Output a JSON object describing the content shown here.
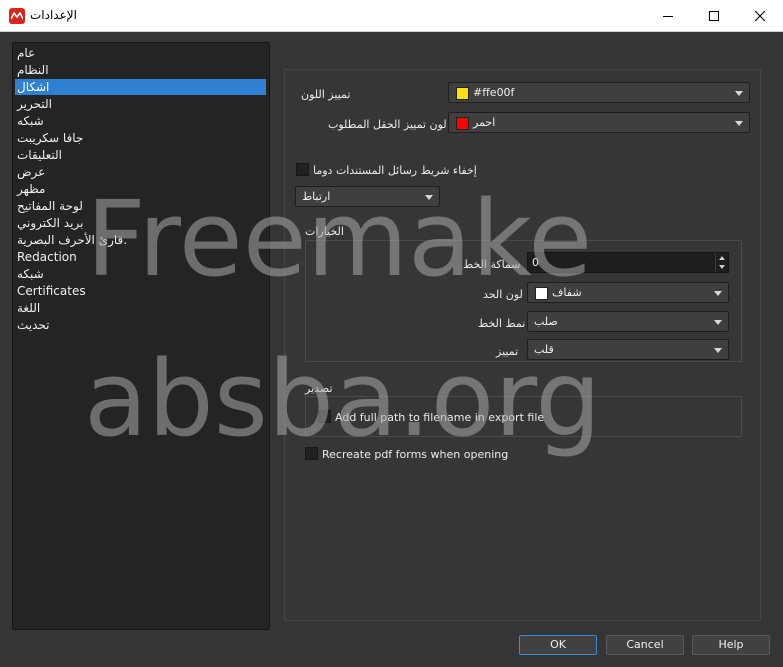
{
  "window": {
    "title": "الإعدادات",
    "buttons": {
      "minimize": "minimize-icon",
      "maximize": "maximize-icon",
      "close": "close-icon"
    }
  },
  "sidebar": {
    "items": [
      {
        "label": "عام"
      },
      {
        "label": "النظام"
      },
      {
        "label": "اشكال",
        "selected": true
      },
      {
        "label": "التحرير"
      },
      {
        "label": "شبكه"
      },
      {
        "label": "جافا سكريبت"
      },
      {
        "label": "التعليقات"
      },
      {
        "label": "عرض"
      },
      {
        "label": "مظهر"
      },
      {
        "label": "لوحة المفاتيح"
      },
      {
        "label": "بريد الكتروني"
      },
      {
        "label": "قارئ الأحرف البصرية."
      },
      {
        "label": "Redaction"
      },
      {
        "label": "شبكه"
      },
      {
        "label": "Certificates"
      },
      {
        "label": "اللغة"
      },
      {
        "label": "تحديث"
      }
    ]
  },
  "form": {
    "highlight_color_label": "تمييز اللون",
    "highlight_color_value": "#ffe00f",
    "highlight_color_swatch": "#ffe00f",
    "required_field_color_label": "لون تمييز الحقل المطلوب",
    "required_field_color_value": "احمر",
    "required_field_color_swatch": "#ff0000",
    "hide_doc_messages_label": "إخفاء شريط رسائل المستندات دوما",
    "link_combo_value": "ارتباط",
    "options_group_title": "الخيارات",
    "line_thickness_label": "سماكة الخط",
    "line_thickness_value": "0",
    "border_color_label": "لون الحد",
    "border_color_value": "شفاف",
    "border_color_swatch": "#ffffff",
    "line_style_label": "نمط الخط",
    "line_style_value": "صلب",
    "highlight_label": "تمييز",
    "highlight_value": "قلب",
    "export_group_title": "تصدير",
    "export_full_path_label": "Add full path to filename in export file",
    "recreate_forms_label": "Recreate pdf forms when opening"
  },
  "footer": {
    "ok": "OK",
    "cancel": "Cancel",
    "help": "Help"
  },
  "watermark": {
    "line1": "Freemake",
    "line2": "absba.org"
  },
  "colors": {
    "accent": "#2f7fd3",
    "background": "#353535",
    "sidebar": "#242424",
    "app_icon": "#d9251c"
  }
}
